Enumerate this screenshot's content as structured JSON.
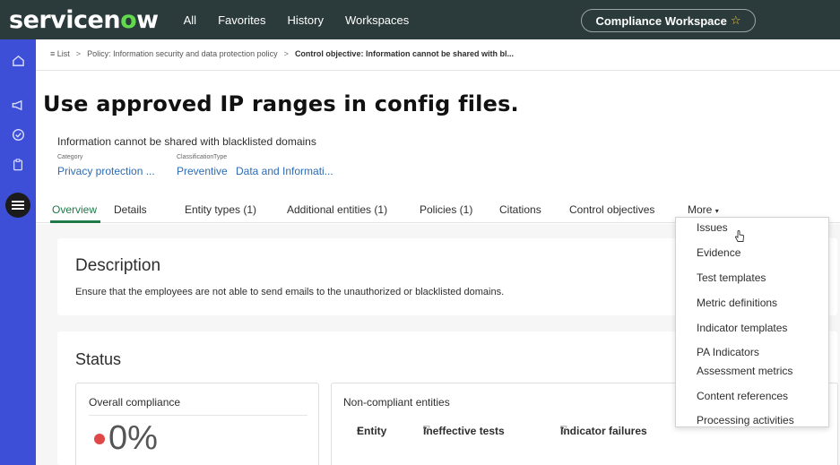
{
  "app": {
    "logo_prefix": "servicen",
    "logo_o": "o",
    "logo_suffix": "w",
    "nav": [
      "All",
      "Favorites",
      "History",
      "Workspaces"
    ],
    "workspace": "Compliance Workspace",
    "star": "☆"
  },
  "rail": {
    "icons": [
      "home-icon",
      "megaphone-icon",
      "check-circle-icon",
      "clipboard-icon",
      "list-icon"
    ]
  },
  "breadcrumb": {
    "list_icon": "≡",
    "list": "List",
    "sep": ">",
    "policy": "Policy: Information security and data protection policy",
    "current": "Control objective: Information cannot be shared with bl..."
  },
  "caption": "Use approved IP ranges in config files.",
  "record": {
    "title": "Information cannot be shared with blacklisted domains",
    "category_label": "Category",
    "classification_label": "Classification",
    "type_label": "Type",
    "category": "Privacy protection ...",
    "classification": "Preventive",
    "type": "Data and Informati..."
  },
  "tabs": [
    "Overview",
    "Details",
    "Entity types (1)",
    "Additional entities (1)",
    "Policies (1)",
    "Citations",
    "Control objectives",
    "More"
  ],
  "more_caret": "▾",
  "description": {
    "title": "Description",
    "text": "Ensure that the employees are not able to send emails to the unauthorized or blacklisted domains."
  },
  "status": {
    "title": "Status",
    "overall_label": "Overall compliance",
    "overall_value": "0%",
    "noncompliant_label": "Non-compliant entities",
    "columns": [
      "Entity",
      "Ineffective tests",
      "Indicator failures"
    ],
    "sort_up": "▴",
    "sort_down": "▾",
    "filter": "▽"
  },
  "more_menu": [
    "Issues",
    "Evidence",
    "Test templates",
    "Metric definitions",
    "Indicator templates",
    "PA Indicators",
    "Assessment metrics",
    "Content references",
    "Processing activities"
  ],
  "colors": {
    "topbar": "#2b3a3a",
    "rail": "#3d4fd6",
    "accent_green": "#1f7a48",
    "link_blue": "#2d6bb4",
    "status_red": "#e04848"
  }
}
